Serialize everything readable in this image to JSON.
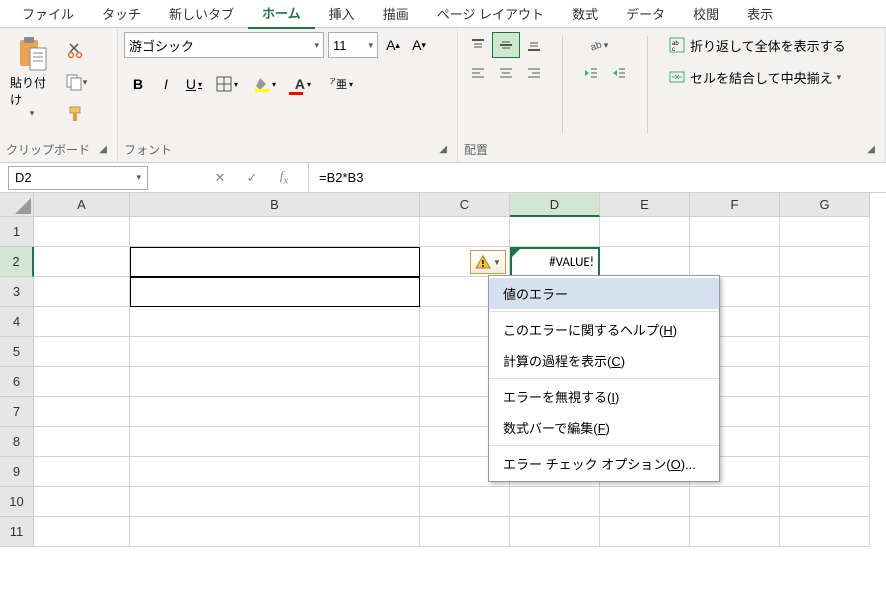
{
  "tabs": {
    "file": "ファイル",
    "touch": "タッチ",
    "newtab": "新しいタブ",
    "home": "ホーム",
    "insert": "挿入",
    "draw": "描画",
    "page_layout": "ページ レイアウト",
    "formulas": "数式",
    "data": "データ",
    "review": "校閲",
    "view": "表示"
  },
  "ribbon": {
    "clipboard": {
      "paste": "貼り付け",
      "label": "クリップボード"
    },
    "font": {
      "name": "游ゴシック",
      "size": "11",
      "bold": "B",
      "italic": "I",
      "underline": "U",
      "label": "フォント"
    },
    "alignment": {
      "wrap": "折り返して全体を表示する",
      "merge": "セルを結合して中央揃え",
      "label": "配置"
    }
  },
  "formula_bar": {
    "name_box": "D2",
    "formula": "=B2*B3"
  },
  "columns": {
    "A": "A",
    "B": "B",
    "C": "C",
    "D": "D",
    "E": "E",
    "F": "F",
    "G": "G"
  },
  "rows": [
    "1",
    "2",
    "3",
    "4",
    "5",
    "6",
    "7",
    "8",
    "9",
    "10",
    "11"
  ],
  "cells": {
    "D2": "#VALUE!"
  },
  "error_menu": {
    "title": "値のエラー",
    "help_pre": "このエラーに関するヘルプ(",
    "help_u": "H",
    "help_post": ")",
    "steps_pre": "計算の過程を表示(",
    "steps_u": "C",
    "steps_post": ")",
    "ignore_pre": "エラーを無視する(",
    "ignore_u": "I",
    "ignore_post": ")",
    "edit_pre": "数式バーで編集(",
    "edit_u": "F",
    "edit_post": ")",
    "options_pre": "エラー チェック オプション(",
    "options_u": "O",
    "options_post": ")..."
  },
  "col_widths": {
    "A": 96,
    "B": 290,
    "C": 90,
    "D": 90,
    "E": 90,
    "F": 90,
    "G": 90
  }
}
